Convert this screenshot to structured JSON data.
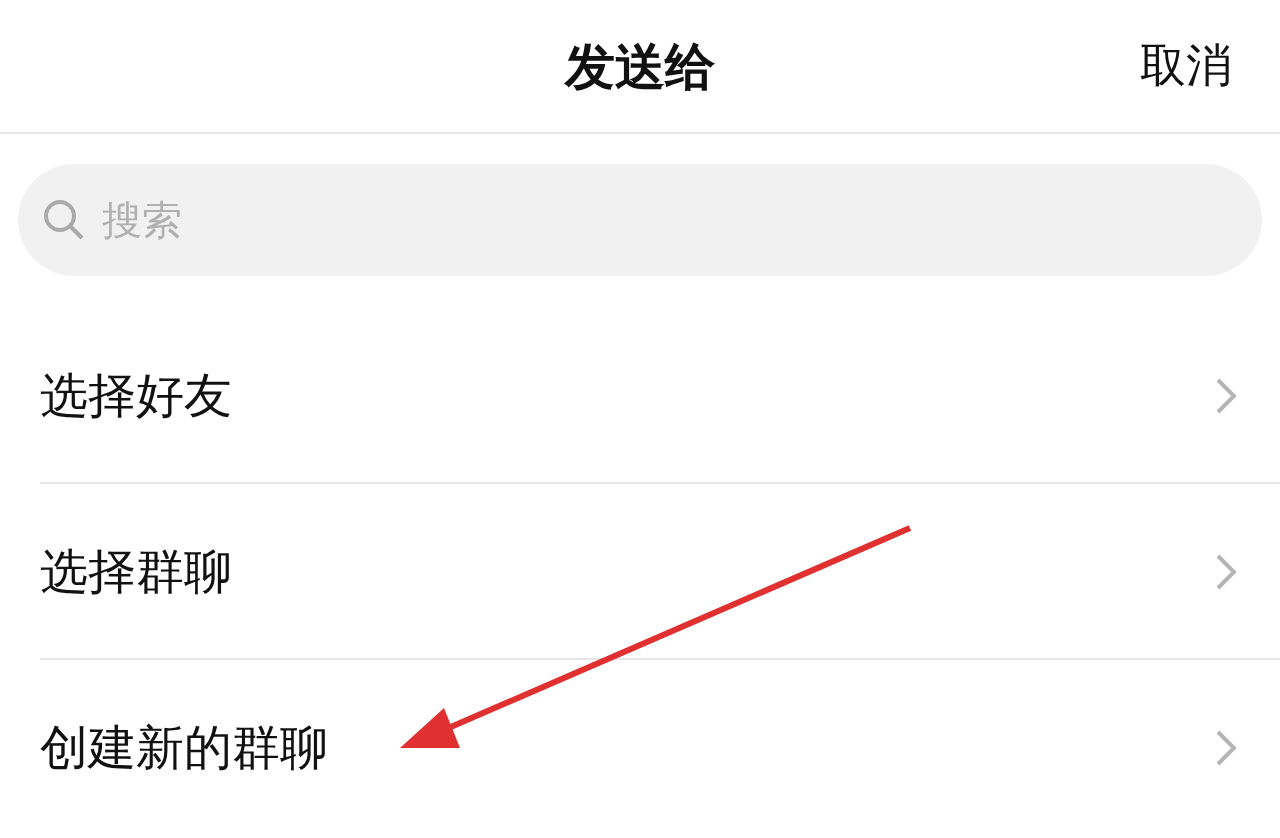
{
  "header": {
    "title": "发送给",
    "cancel": "取消"
  },
  "search": {
    "placeholder": "搜索"
  },
  "items": [
    {
      "label": "选择好友"
    },
    {
      "label": "选择群聊"
    },
    {
      "label": "创建新的群聊"
    }
  ],
  "annotation": {
    "kind": "arrow"
  }
}
